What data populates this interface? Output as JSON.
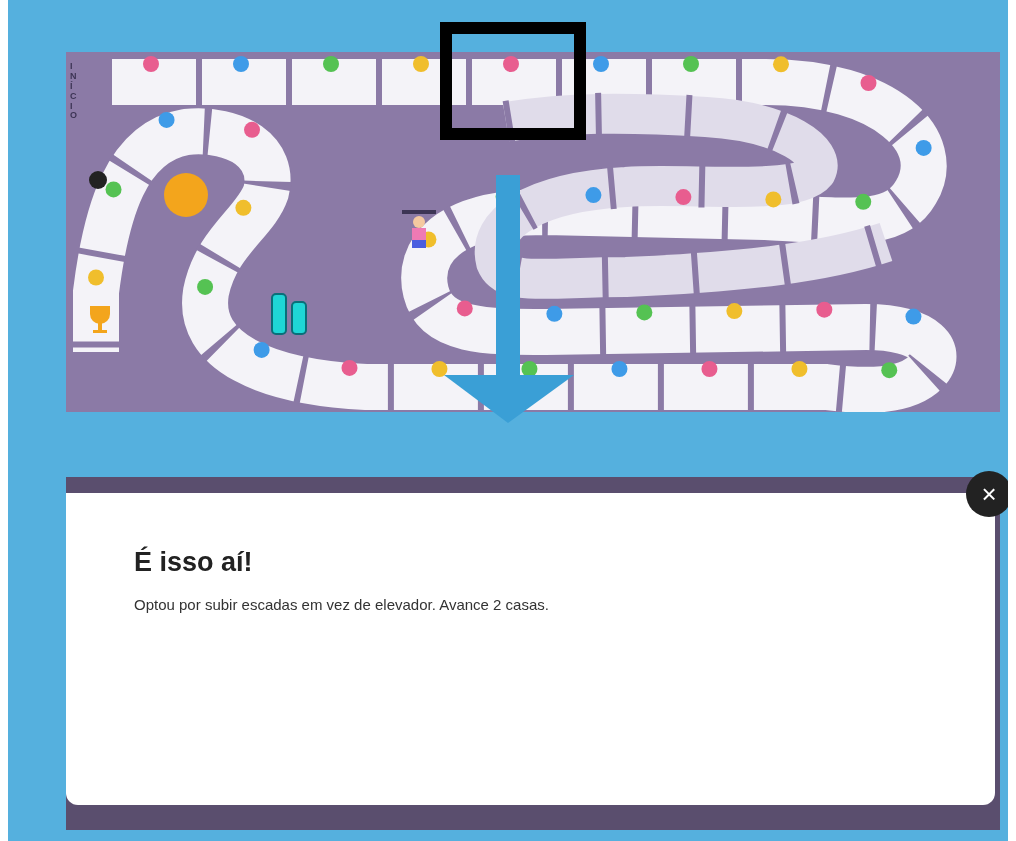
{
  "board": {
    "start_label": "INÍCIO"
  },
  "dialog": {
    "title": "É isso aí!",
    "message": "Optou por subir escadas em vez de elevador. Avance 2 casas.",
    "close": "×"
  }
}
